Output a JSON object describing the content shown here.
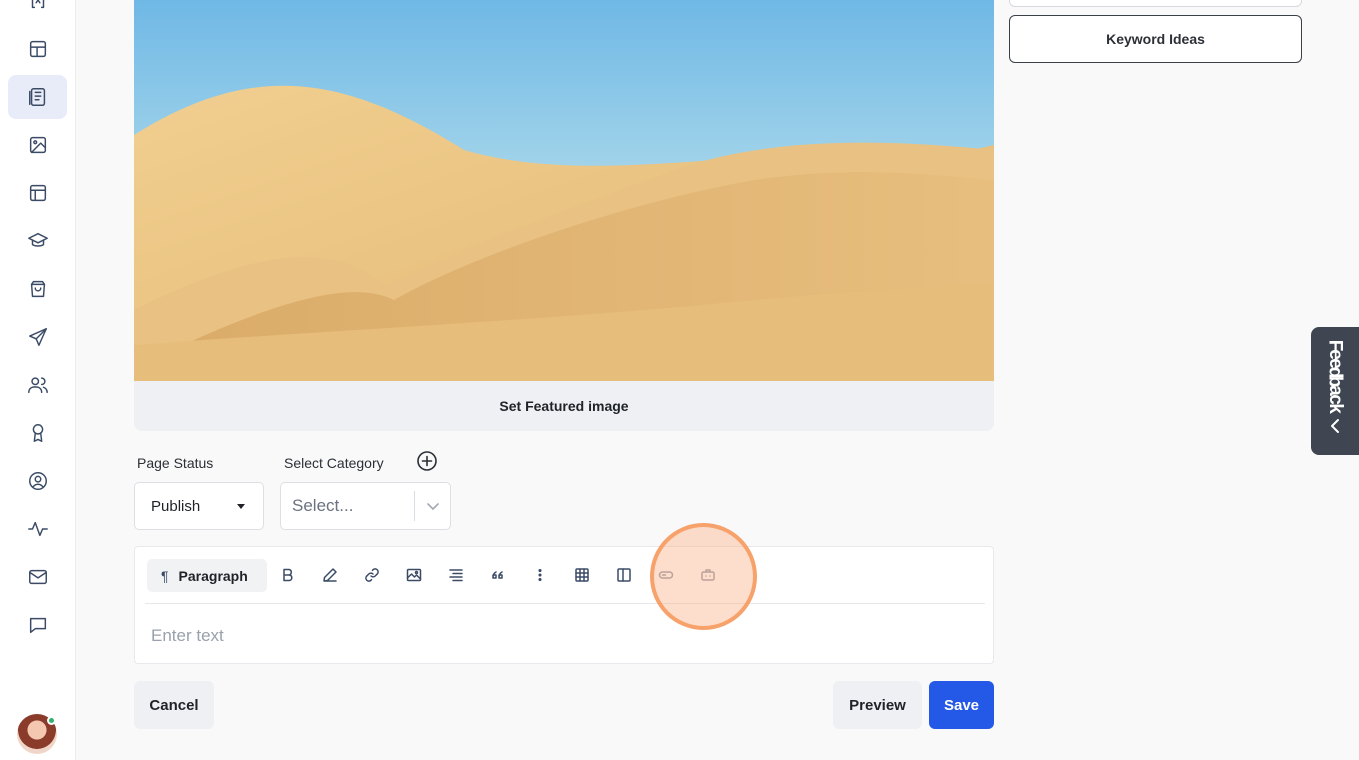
{
  "sidebar": {
    "items": [
      {
        "icon": "code-bracket-icon"
      },
      {
        "icon": "dashboard-icon"
      },
      {
        "icon": "pages-icon",
        "active": true
      },
      {
        "icon": "image-gallery-icon"
      },
      {
        "icon": "layout-icon"
      },
      {
        "icon": "graduation-cap-icon"
      },
      {
        "icon": "shopping-bag-icon"
      },
      {
        "icon": "send-icon"
      },
      {
        "icon": "users-icon"
      },
      {
        "icon": "award-icon"
      },
      {
        "icon": "user-circle-icon"
      },
      {
        "icon": "activity-icon"
      },
      {
        "icon": "mail-icon"
      },
      {
        "icon": "chat-icon"
      }
    ]
  },
  "featured_image": {
    "label": "Set Featured image"
  },
  "page_status": {
    "label": "Page Status",
    "value": "Publish"
  },
  "category": {
    "label": "Select Category",
    "placeholder": "Select..."
  },
  "editor": {
    "block_type": "Paragraph",
    "placeholder": "Enter text",
    "tools": [
      "bold-icon",
      "pen-icon",
      "link-icon",
      "image-icon",
      "align-icon",
      "quote-icon",
      "more-vertical-icon",
      "table-icon",
      "columns-icon",
      "button-icon",
      "embed-icon"
    ]
  },
  "actions": {
    "cancel": "Cancel",
    "preview": "Preview",
    "save": "Save"
  },
  "right_panel": {
    "keyword_ideas": "Keyword Ideas"
  },
  "feedback": {
    "label": "Feedback"
  },
  "colors": {
    "primary": "#2458e6",
    "highlight": "#f6965a"
  }
}
